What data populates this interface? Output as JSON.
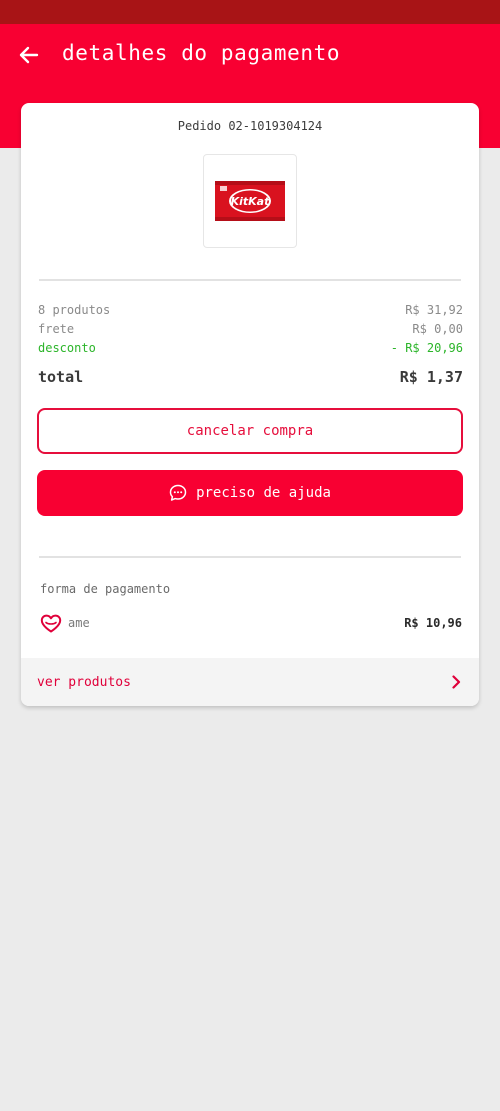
{
  "header": {
    "title": "detalhes do pagamento",
    "back_icon": "arrow-left-icon"
  },
  "order": {
    "id_label": "Pedido 02-1019304124",
    "product_image": "kitkat-product-image",
    "product_brand": "KitKat"
  },
  "summary": {
    "products_label": "8 produtos",
    "products_value": "R$ 31,92",
    "shipping_label": "frete",
    "shipping_value": "R$ 0,00",
    "discount_label": "desconto",
    "discount_value": "- R$ 20,96",
    "total_label": "total",
    "total_value": "R$ 1,37"
  },
  "actions": {
    "cancel_label": "cancelar compra",
    "help_label": "preciso de ajuda",
    "help_icon": "chat-bubble-icon"
  },
  "payment": {
    "section_label": "forma de pagamento",
    "method_label": "ame",
    "method_icon": "heart-icon",
    "amount": "R$ 10,96"
  },
  "footer": {
    "link_label": "ver produtos",
    "link_icon": "chevron-right-icon"
  },
  "colors": {
    "brand_red": "#f80032",
    "status_bar": "#a81416",
    "discount_green": "#2cb52a",
    "background": "#ebebeb"
  }
}
